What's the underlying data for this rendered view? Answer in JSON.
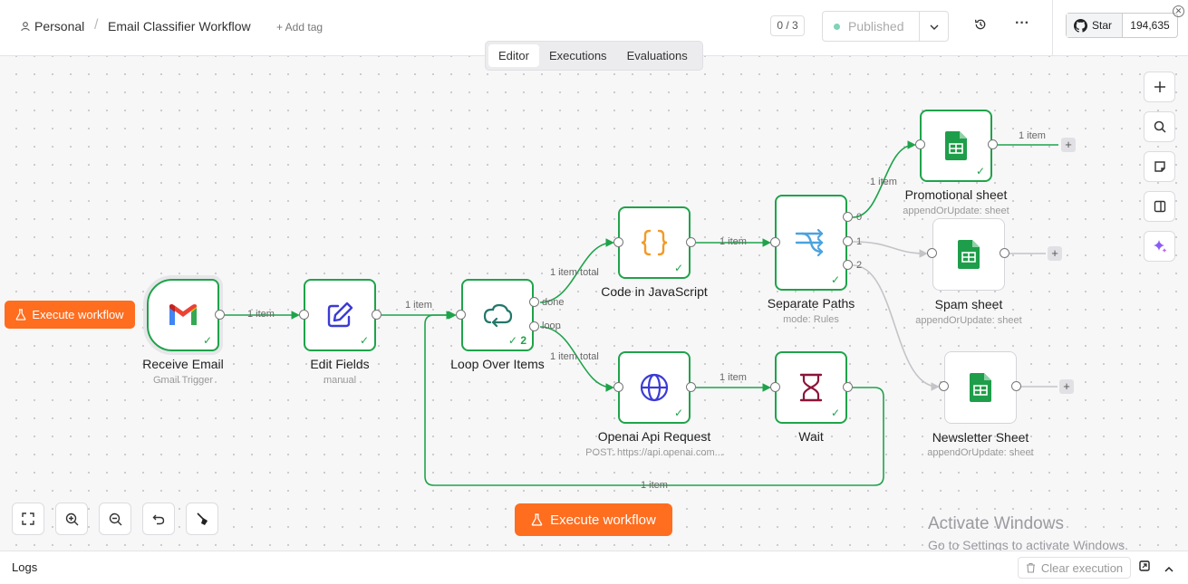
{
  "header": {
    "workspace": "Personal",
    "separator": "/",
    "workflow_name": "Email Classifier Workflow",
    "add_tag": "+ Add tag",
    "counter": "0 / 3",
    "status": "Published",
    "github_star": "Star",
    "github_count": "194,635"
  },
  "tabs": [
    {
      "label": "Editor",
      "active": true
    },
    {
      "label": "Executions",
      "active": false
    },
    {
      "label": "Evaluations",
      "active": false
    }
  ],
  "buttons": {
    "execute_workflow": "Execute workflow"
  },
  "nodes": {
    "receive_email": {
      "title": "Receive Email",
      "subtitle": "Gmail Trigger",
      "icon": "gmail-icon"
    },
    "edit_fields": {
      "title": "Edit Fields",
      "subtitle": "manual",
      "icon": "pencil-square-icon"
    },
    "loop": {
      "title": "Loop Over Items",
      "subtitle": "",
      "icon": "loop-icon",
      "run_count": "2"
    },
    "code_js": {
      "title": "Code in JavaScript",
      "subtitle": "",
      "icon": "braces-icon"
    },
    "openai": {
      "title": "Openai Api Request",
      "subtitle": "POST: https://api.openai.com...",
      "icon": "globe-icon"
    },
    "wait": {
      "title": "Wait",
      "subtitle": "",
      "icon": "hourglass-icon"
    },
    "separate": {
      "title": "Separate Paths",
      "subtitle": "mode: Rules",
      "icon": "switch-icon"
    },
    "promo": {
      "title": "Promotional sheet",
      "subtitle": "appendOrUpdate: sheet",
      "icon": "google-sheets-icon"
    },
    "spam": {
      "title": "Spam sheet",
      "subtitle": "appendOrUpdate: sheet",
      "icon": "google-sheets-icon"
    },
    "newsletter": {
      "title": "Newsletter Sheet",
      "subtitle": "appendOrUpdate: sheet",
      "icon": "google-sheets-icon"
    }
  },
  "edge_labels": {
    "one_item": "1 item",
    "one_item_total": "1 item total",
    "done": "done",
    "loop": "loop",
    "out0": "0",
    "out1": "1",
    "out2": "2"
  },
  "colors": {
    "success": "#1fa34a",
    "accent": "#ff6d1f",
    "idle_edge": "#c4c4c8",
    "sheets_green": "#1e9e4a"
  },
  "watermark": {
    "line1": "Activate Windows",
    "line2": "Go to Settings to activate Windows."
  },
  "logs": {
    "title": "Logs",
    "clear": "Clear execution"
  }
}
